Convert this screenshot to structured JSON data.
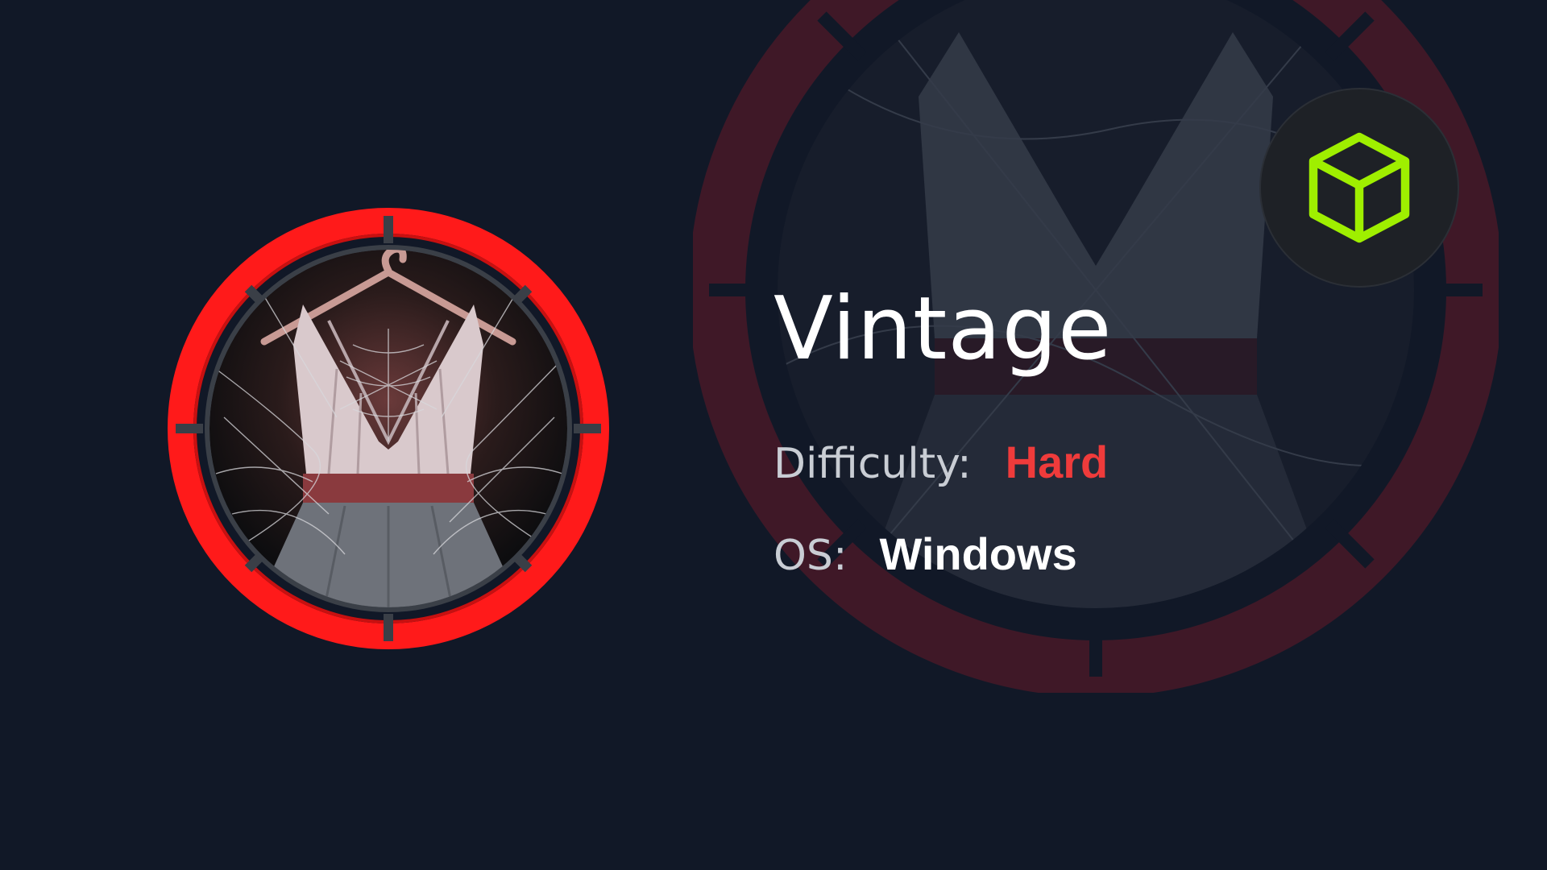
{
  "machine": {
    "name": "Vintage",
    "difficulty_label": "Difficulty:",
    "difficulty_value": "Hard",
    "os_label": "OS:",
    "os_value": "Windows"
  },
  "colors": {
    "background": "#111827",
    "ring": "#ff1a1a",
    "difficulty": "#ef3b3b",
    "logo_green": "#9fef00"
  },
  "icons": {
    "avatar": "dress-on-hanger-with-cobwebs",
    "logo": "hackthebox-cube-icon"
  }
}
